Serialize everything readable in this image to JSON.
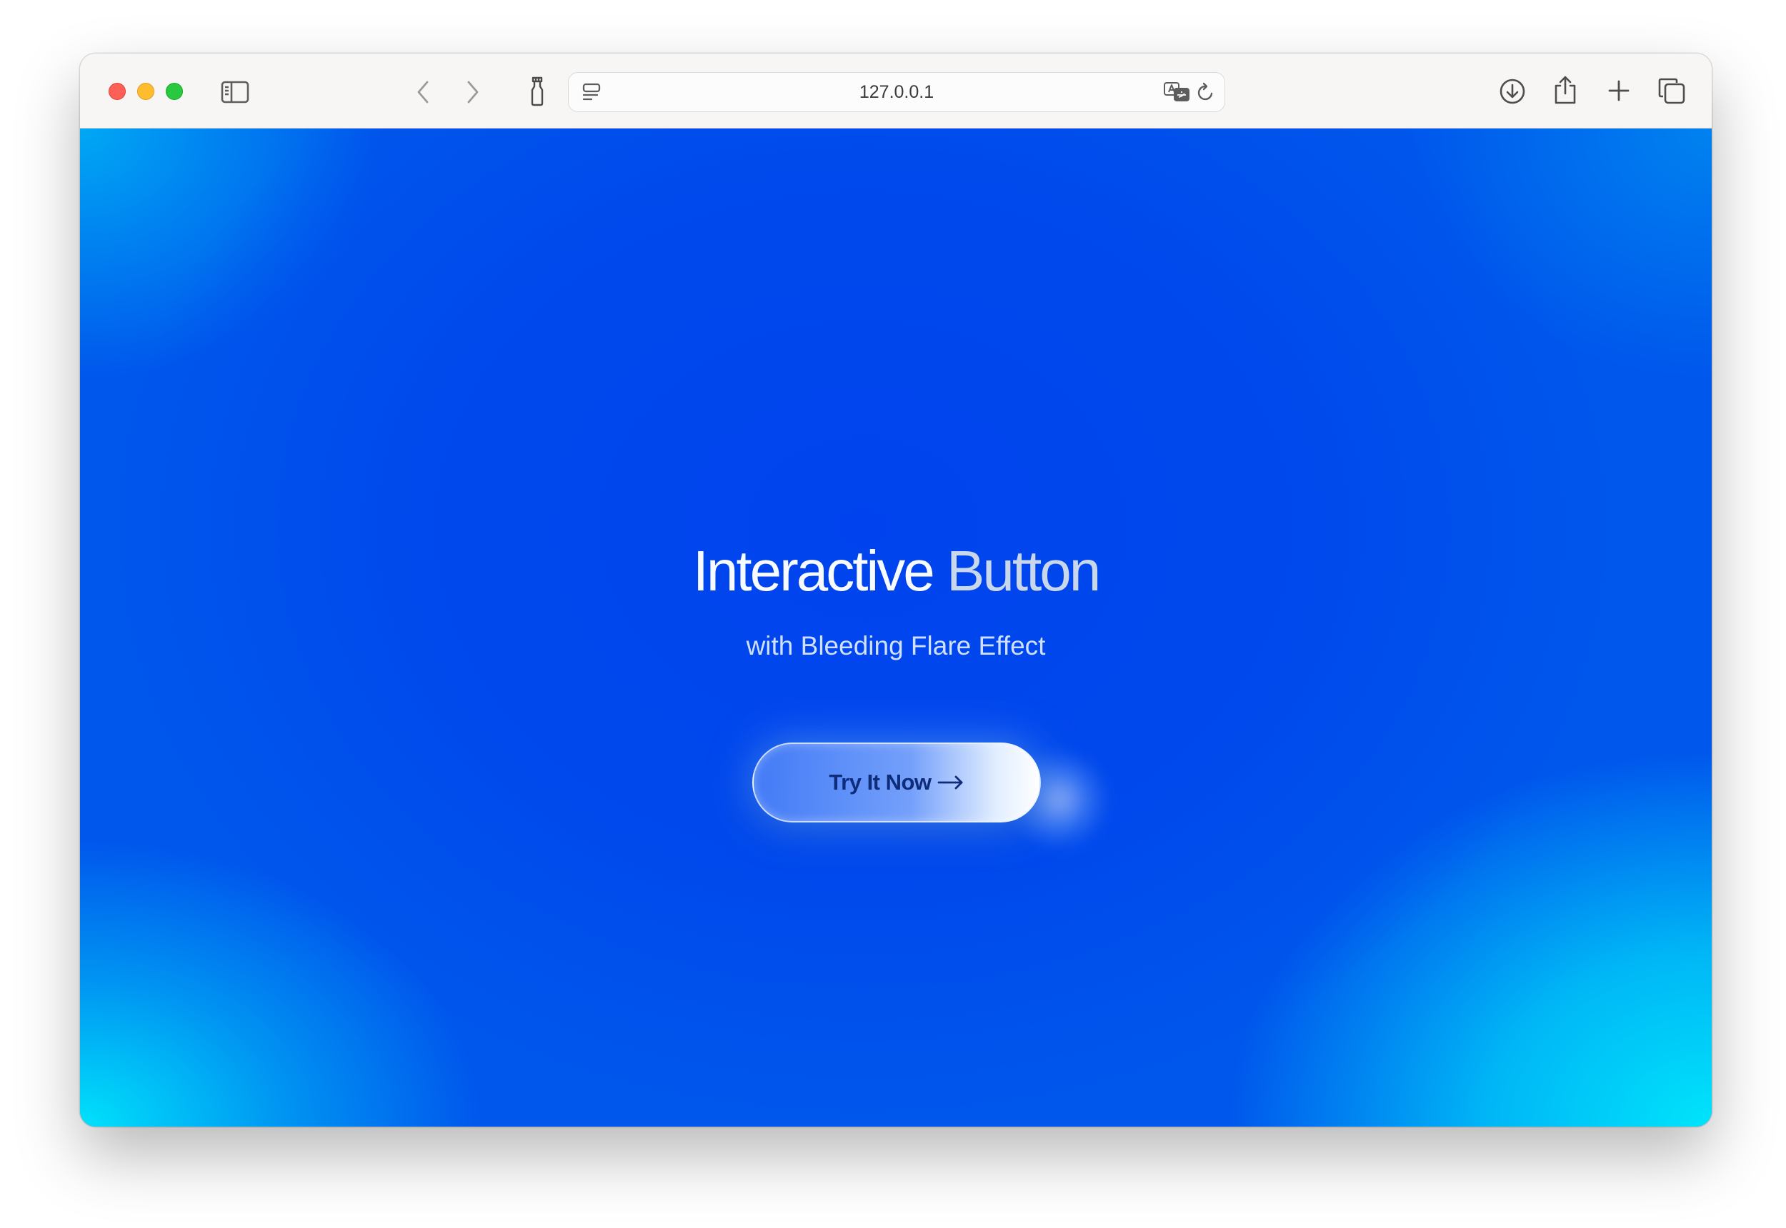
{
  "browser": {
    "address": "127.0.0.1",
    "controls": {
      "close_color": "#fe5f57",
      "minimize_color": "#febc2e",
      "maximize_color": "#28c840"
    },
    "toolbar_icons": [
      "sidebar-icon",
      "back-icon",
      "forward-icon",
      "extension-icon",
      "page-settings-icon",
      "translate-icon",
      "reload-icon",
      "download-icon",
      "share-icon",
      "new-tab-icon",
      "tab-overview-icon"
    ]
  },
  "page": {
    "title_part1": "Interactive",
    "title_part2": "Button",
    "subtitle": "with Bleeding Flare Effect",
    "cta_label": "Try It Now",
    "cta_icon": "arrow-right-icon",
    "colors": {
      "background_primary": "#0050ec",
      "background_accent": "#00e4fb",
      "cta_text": "#0e2c7a"
    }
  }
}
